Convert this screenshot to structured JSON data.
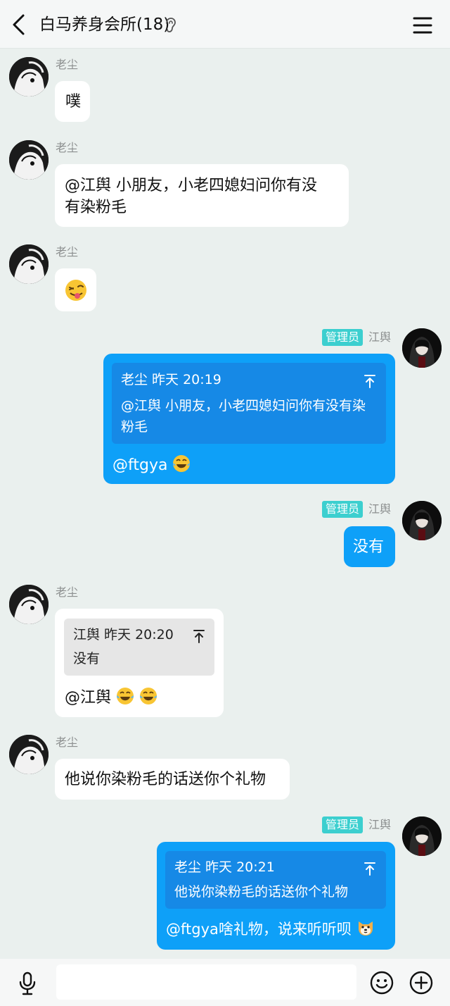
{
  "header": {
    "title": "白马养身会所(18)"
  },
  "messages": [
    {
      "sender": "老尘",
      "text": "噗"
    },
    {
      "sender": "老尘",
      "text_line1": "@江舆 小朋友，小老四媳妇问你有没",
      "text_line2": "有染粉毛"
    },
    {
      "sender": "老尘",
      "emoji": "tongue-out-wink-emoji"
    },
    {
      "badge": "管理员",
      "sender": "江舆",
      "quote_meta": "老尘 昨天 20:19",
      "quote_line1": "@江舆 小朋友，小老四媳妇问你有没有染",
      "quote_line2": "粉毛",
      "text": "@ftgya"
    },
    {
      "badge": "管理员",
      "sender": "江舆",
      "text": "没有"
    },
    {
      "sender": "老尘",
      "quote_meta": "江舆 昨天 20:20",
      "quote_line1": "没有",
      "text": "@江舆"
    },
    {
      "sender": "老尘",
      "text": "他说你染粉毛的话送你个礼物"
    },
    {
      "badge": "管理员",
      "sender": "江舆",
      "quote_meta": "老尘 昨天 20:21",
      "quote_line1": "他说你染粉毛的话送你个礼物",
      "text": "@ftgya啥礼物，说来听听呗"
    }
  ],
  "colors": {
    "accent": "#0ea0f8",
    "admin_badge": "#3ccfcf",
    "background": "#eaf0ee"
  }
}
